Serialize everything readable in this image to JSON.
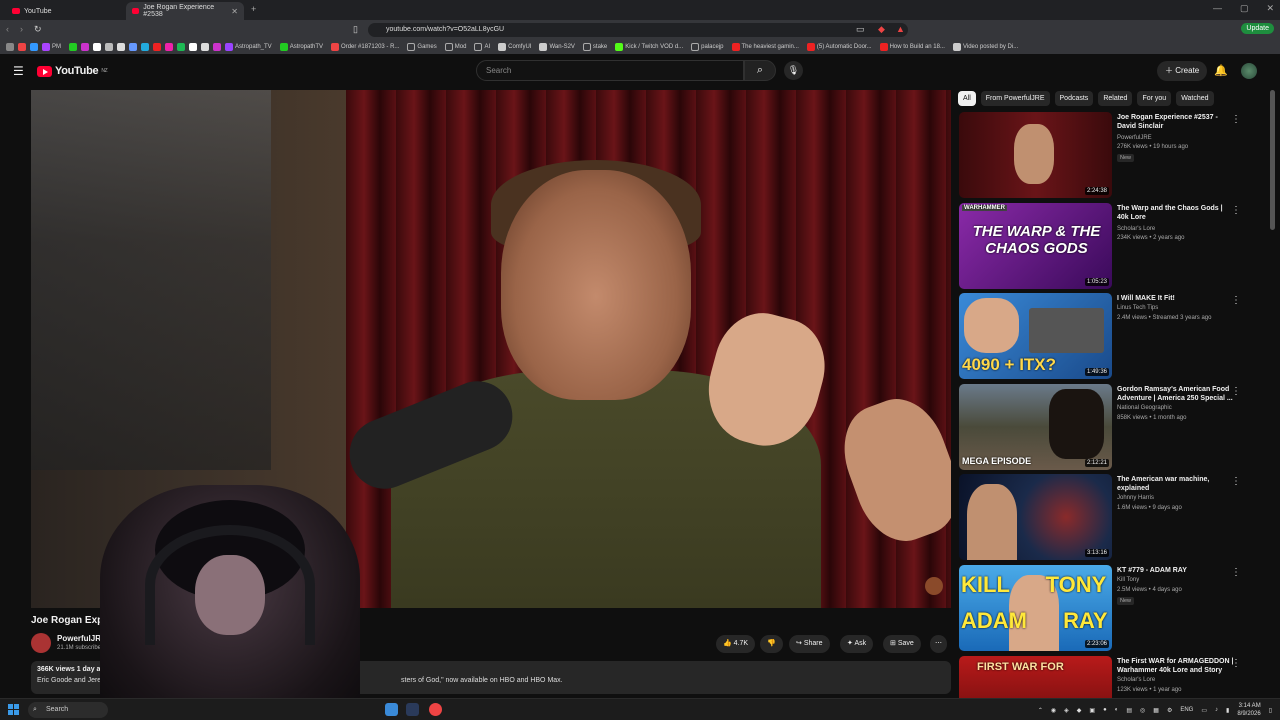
{
  "browser": {
    "tabs": [
      {
        "label": "YouTube"
      },
      {
        "label": "Joe Rogan Experience #2538"
      }
    ],
    "url": "youtube.com/watch?v=O52aLL8ycGU",
    "update_label": "Update",
    "bookmarks": [
      "PM",
      "Astropath_TV",
      "AstropathTV",
      "Order #1871203 - R...",
      "Games",
      "Mod",
      "AI",
      "ComfyUI",
      "Wan-S2V",
      "stake",
      "Kick / Twitch VOD d...",
      "palacejp",
      "The heaviest gamin...",
      "(5) Automatic Door...",
      "How to Build an 18...",
      "Video posted by Di..."
    ]
  },
  "yt": {
    "logo": "YouTube",
    "region": "NZ",
    "search_placeholder": "Search",
    "create_label": "Create"
  },
  "video": {
    "title": "Joe Rogan Experie",
    "channel": "PowerfulJRE",
    "subs": "21.1M subscribers",
    "likes": "4.7K",
    "share": "Share",
    "ask": "Ask",
    "save": "Save",
    "desc_meta": "366K views  1 day ago",
    "desc_line": "Eric Goode and Jerem",
    "desc_tail": "sters of God,\" now available on HBO and HBO Max."
  },
  "chips": [
    "All",
    "From PowerfulJRE",
    "Podcasts",
    "Related",
    "For you",
    "Watched"
  ],
  "related": [
    {
      "title": "Joe Rogan Experience #2537 - David Sinclair",
      "channel": "PowerfulJRE",
      "meta": "276K views • 19 hours ago",
      "badge": "New",
      "duration": "2:24:38",
      "color": "#5a1418"
    },
    {
      "title": "The Warp and the Chaos Gods | 40k Lore",
      "channel": "Scholar's Lore",
      "meta": "234K views • 2 years ago",
      "badge": "",
      "duration": "1:05:23",
      "color": "#6a2a8a",
      "thumb_text": "THE WARP & THE CHAOS GODS",
      "thumb_tag": "WARHAMMER"
    },
    {
      "title": "I Will MAKE It Fit!",
      "channel": "Linus Tech Tips",
      "meta": "2.4M views • Streamed 3 years ago",
      "badge": "",
      "duration": "1:49:36",
      "color": "#2a6aa8",
      "thumb_text": "4090 + ITX?"
    },
    {
      "title": "Gordon Ramsay's American Food Adventure | America 250 Special ...",
      "channel": "National Geographic",
      "meta": "858K views • 1 month ago",
      "badge": "",
      "duration": "2:12:21",
      "color": "#3a4a3a",
      "thumb_text": "MEGA EPISODE"
    },
    {
      "title": "The American war machine, explained",
      "channel": "Johnny Harris",
      "meta": "1.6M views • 9 days ago",
      "badge": "",
      "duration": "3:13:16",
      "color": "#1a2a4a"
    },
    {
      "title": "KT #779 - ADAM RAY",
      "channel": "Kill Tony",
      "meta": "2.5M views • 4 days ago",
      "badge": "New",
      "duration": "2:23:06",
      "color": "#2a8ad8",
      "thumb_text": "KILL TONY ADAM RAY"
    },
    {
      "title": "The First WAR for ARMAGEDDON | Warhammer 40k Lore and Story",
      "channel": "Scholar's Lore",
      "meta": "123K views • 1 year ago",
      "badge": "",
      "duration": "",
      "color": "#8a1a1a",
      "thumb_text": "FIRST WAR FOR"
    }
  ],
  "taskbar": {
    "search": "Search",
    "lang": "ENG",
    "time": "3:14 AM",
    "date": "8/9/2026"
  }
}
